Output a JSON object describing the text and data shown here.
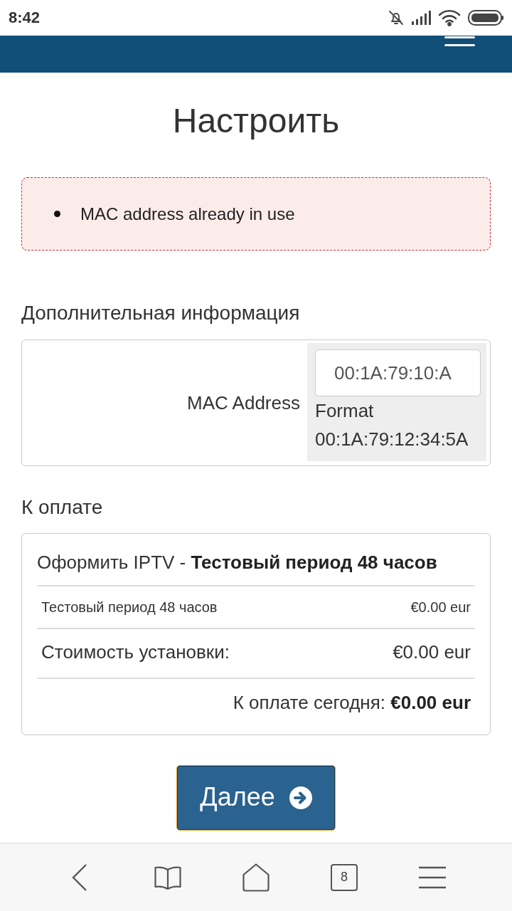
{
  "status_bar": {
    "time": "8:42"
  },
  "page": {
    "title": "Настроить"
  },
  "alert": {
    "messages": [
      "MAC address already in use"
    ]
  },
  "additional_info": {
    "heading": "Дополнительная информация",
    "fields": [
      {
        "label": "MAC Address",
        "value": "00:1A:79:10:A",
        "help": "Format 00:1A:79:12:34:5A"
      }
    ]
  },
  "payment": {
    "heading": "К оплате",
    "title": "Оформить IPTV - **Тестовый период 48 часов**",
    "lines": [
      {
        "kind": "detail",
        "label": "Тестовый период 48 часов",
        "amount": "€0.00 eur"
      },
      {
        "kind": "fee",
        "label": "Стоимость установки:",
        "amount": "€0.00 eur"
      }
    ],
    "total": "К оплате сегодня: **€0.00 eur**"
  },
  "next_button": {
    "label": "Далее"
  },
  "browser_bar": {
    "tab_count": "8"
  }
}
